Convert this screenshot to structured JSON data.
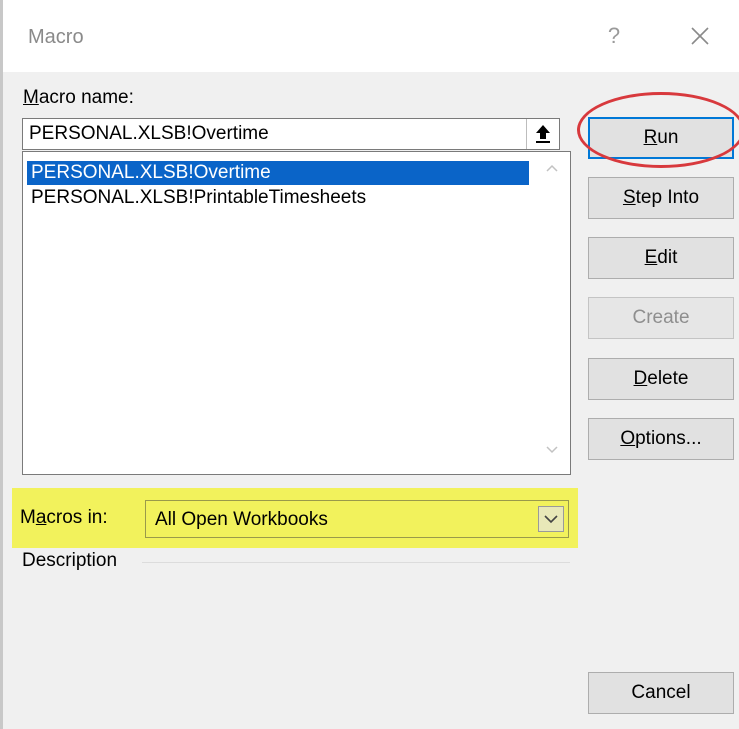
{
  "dialog": {
    "title": "Macro",
    "help_glyph": "?"
  },
  "macro_name": {
    "label_first": "M",
    "label_rest": "acro name:",
    "value": "PERSONAL.XLSB!Overtime"
  },
  "macro_list": {
    "items": [
      {
        "label": "PERSONAL.XLSB!Overtime",
        "selected": true
      },
      {
        "label": "PERSONAL.XLSB!PrintableTimesheets",
        "selected": false
      }
    ]
  },
  "buttons": {
    "run": {
      "ul": "R",
      "rest": "un"
    },
    "step_into": {
      "ul": "S",
      "rest": "tep Into"
    },
    "edit": {
      "ul": "E",
      "rest": "dit"
    },
    "create": {
      "label": "Create"
    },
    "delete": {
      "ul": "D",
      "rest": "elete"
    },
    "options": {
      "ul": "O",
      "rest": "ptions..."
    },
    "cancel": {
      "label": "Cancel"
    }
  },
  "macros_in": {
    "label_pre": "M",
    "label_ul": "a",
    "label_post": "cros in:",
    "value": "All Open Workbooks"
  },
  "description": {
    "label": "Description"
  },
  "annotations": {
    "run_circle_color": "#d8393d",
    "macros_in_highlight_color": "#f2f25c"
  },
  "colors": {
    "selection": "#0a64c8",
    "default_button_border": "#0078d7"
  }
}
